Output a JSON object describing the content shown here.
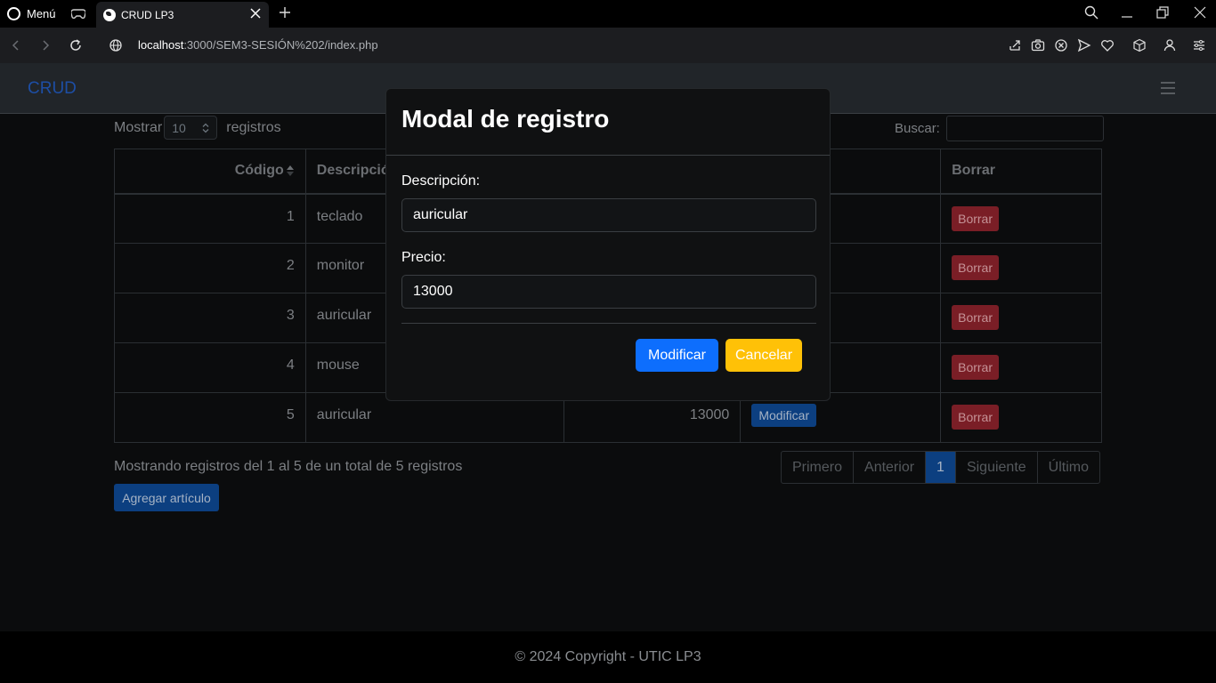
{
  "browser": {
    "menu_label": "Menú",
    "tab_title": "CRUD LP3",
    "url_host": "localhost",
    "url_path": ":3000/SEM3-SESIÓN%202/index.php"
  },
  "navbar": {
    "brand": "CRUD"
  },
  "table_controls": {
    "show_label": "Mostrar",
    "page_length": "10",
    "records_label": "registros",
    "search_label": "Buscar:"
  },
  "table": {
    "headers": {
      "code": "Código",
      "description": "Descripció",
      "delete": "Borrar"
    },
    "rows": [
      {
        "code": "1",
        "description": "teclado",
        "price": "",
        "delete_label": "Borrar"
      },
      {
        "code": "2",
        "description": "monitor",
        "price": "",
        "delete_label": "Borrar"
      },
      {
        "code": "3",
        "description": "auricular",
        "price": "",
        "delete_label": "Borrar"
      },
      {
        "code": "4",
        "description": "mouse",
        "price": "",
        "delete_label": "Borrar"
      },
      {
        "code": "5",
        "description": "auricular",
        "price": "13000",
        "modify_label": "Modificar",
        "delete_label": "Borrar"
      }
    ]
  },
  "info_text": "Mostrando registros del 1 al 5 de un total de 5 registros",
  "pagination": {
    "first": "Primero",
    "prev": "Anterior",
    "current": "1",
    "next": "Siguiente",
    "last": "Último"
  },
  "add_button": "Agregar artículo",
  "footer": "© 2024 Copyright - UTIC LP3",
  "modal": {
    "title": "Modal de registro",
    "description_label": "Descripción:",
    "description_value": "auricular",
    "price_label": "Precio:",
    "price_value": "13000",
    "modify_button": "Modificar",
    "cancel_button": "Cancelar"
  },
  "colors": {
    "primary": "#0d6efd",
    "warning": "#ffc107",
    "danger": "#7a1e26",
    "brand": "#1d4ea5"
  }
}
